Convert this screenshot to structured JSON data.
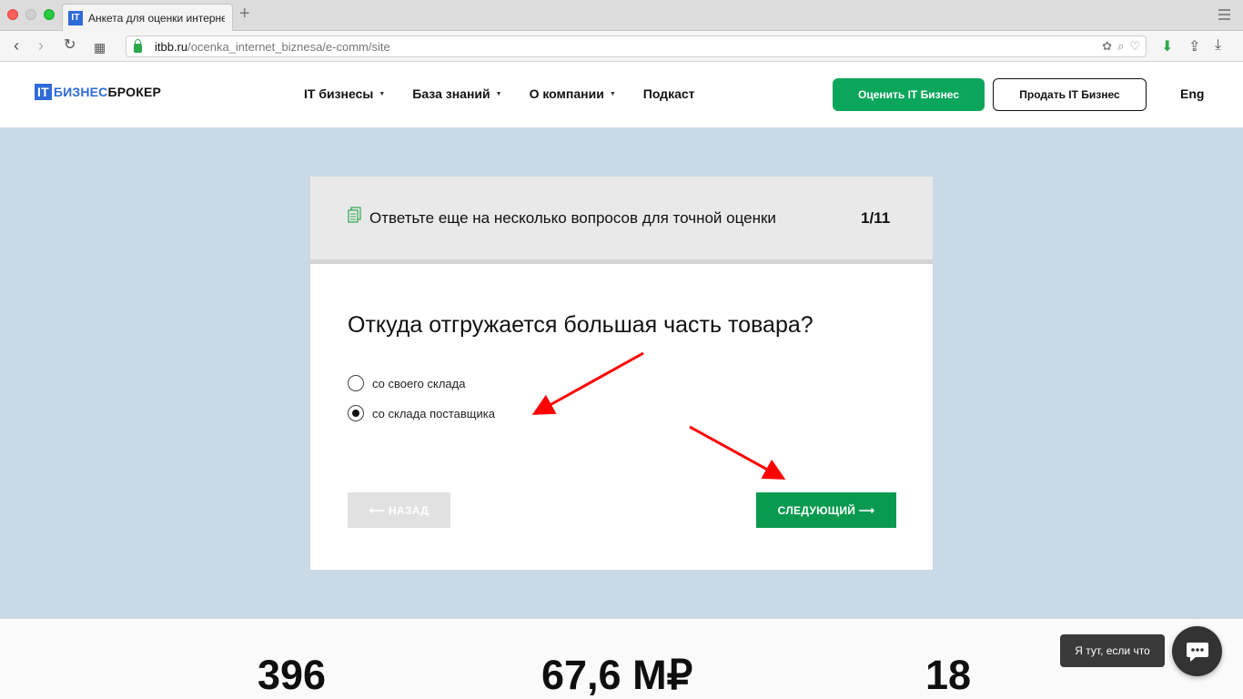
{
  "browser": {
    "tab_title": "Анкета для оценки интерне",
    "tab_favicon": "IT",
    "url_domain": "itbb.ru",
    "url_path": "/ocenka_internet_biznesa/e-comm/site"
  },
  "header": {
    "logo_it": "IT",
    "logo_biz": "БИЗНЕС",
    "logo_brok": "БРОКЕР",
    "nav": [
      {
        "label": "IT бизнесы",
        "dropdown": true
      },
      {
        "label": "База знаний",
        "dropdown": true
      },
      {
        "label": "О компании",
        "dropdown": true
      },
      {
        "label": "Подкаст",
        "dropdown": false
      }
    ],
    "cta_evaluate": "Оценить IT Бизнес",
    "cta_sell": "Продать IT Бизнес",
    "lang": "Eng"
  },
  "survey": {
    "header_text": "Ответьте еще на несколько вопросов для точной оценки",
    "progress": "1/11",
    "question": "Откуда отгружается большая часть товара?",
    "options": [
      {
        "label": "со своего склада",
        "selected": false
      },
      {
        "label": "со склада поставщика",
        "selected": true
      }
    ],
    "back_label": "⟵ НАЗАД",
    "next_label": "СЛЕДУЮЩИЙ ⟶"
  },
  "stats": [
    "396",
    "67,6 М₽",
    "18"
  ],
  "chat": {
    "tooltip": "Я тут, если что"
  },
  "colors": {
    "accent_green": "#0a9a4f",
    "brand_blue": "#2f6bd8",
    "page_bg": "#c9d9e5",
    "annotation_red": "#ff0000"
  }
}
